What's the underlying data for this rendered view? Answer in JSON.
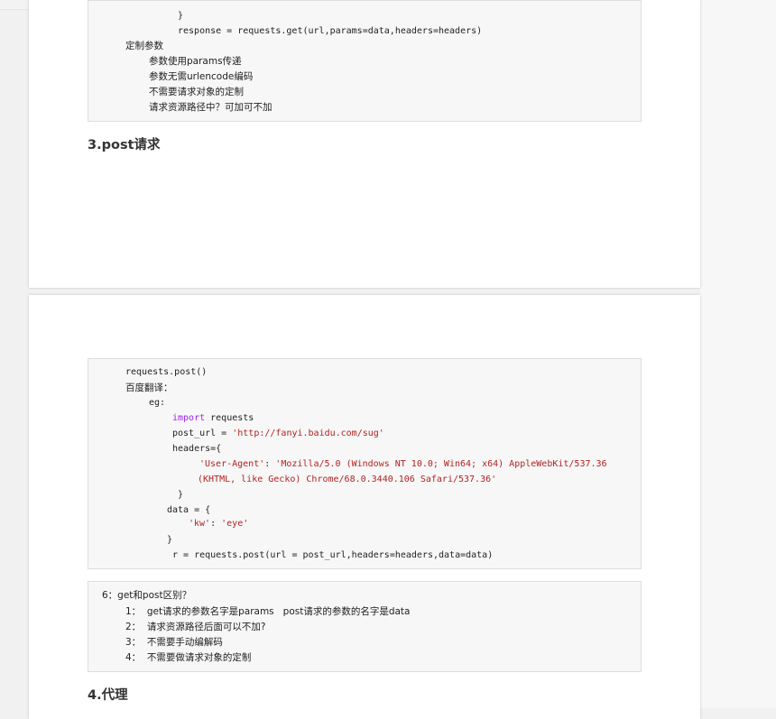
{
  "block1": {
    "brace": "}",
    "response_line": "response = requests.get(url,params=data,headers=headers)",
    "custom_params": "定制参数",
    "item1": "参数使用params传递",
    "item2": "参数无需urlencode编码",
    "item3": "不需要请求对象的定制",
    "item4": "请求资源路径中？可加可不加"
  },
  "heading3": "3.post请求",
  "block2": {
    "call": "requests.post()",
    "baidu": "百度翻译：",
    "eg": "eg:",
    "import_kw": "import",
    "import_mod": " requests",
    "post_url_lhs": "post_url = ",
    "post_url_val": "'http://fanyi.baidu.com/sug'",
    "headers_open": "headers={",
    "ua_key": "'User-Agent'",
    "ua_sep": ": ",
    "ua_val1": "'Mozilla/5.0 (Windows NT 10.0; Win64; x64) AppleWebKit/537.36",
    "ua_val2": "(KHTML, like Gecko) Chrome/68.0.3440.106 Safari/537.36'",
    "close1": "}",
    "data_open": "data = {",
    "kw_key": "'kw'",
    "kw_sep": ": ",
    "kw_val": "'eye'",
    "close2": "}",
    "post_call": "r = requests.post(url = post_url,headers=headers,data=data)"
  },
  "block3": {
    "title": "6：get和post区别？",
    "p1": "1：  get请求的参数名字是params   post请求的参数的名字是data",
    "p2": "2：  请求资源路径后面可以不加?",
    "p3": "3：  不需要手动编解码",
    "p4": "4：  不需要做请求对象的定制"
  },
  "heading4": "4.代理"
}
